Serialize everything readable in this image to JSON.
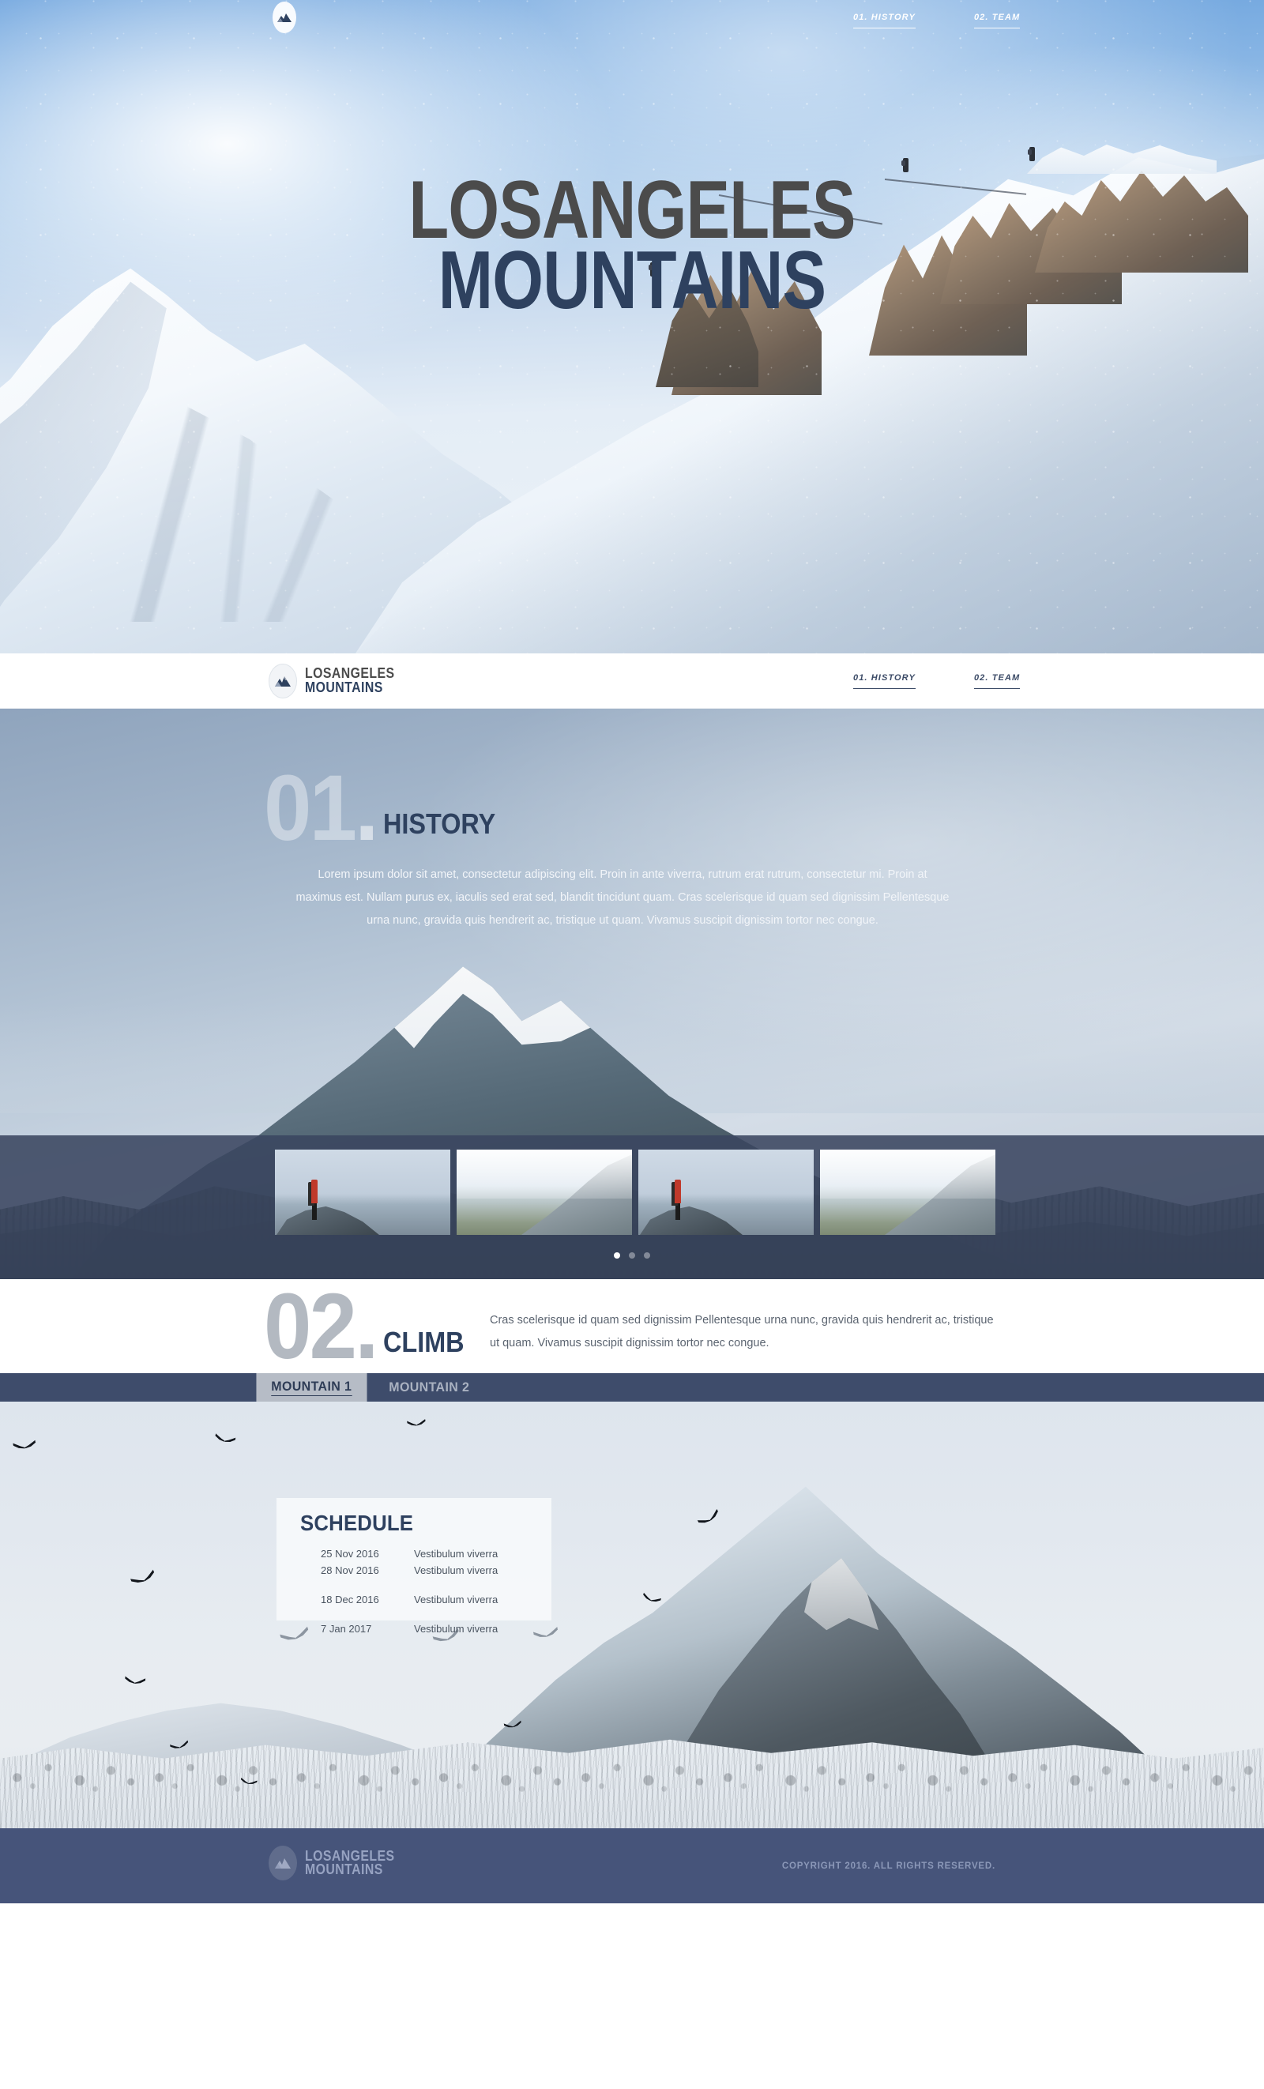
{
  "brand": {
    "line1": "LOSANGELES",
    "line2": "MOUNTAINS",
    "icon": "mountain-badge-icon"
  },
  "hero": {
    "title_top": "LOSANGELES",
    "title_bottom": "MOUNTAINS",
    "nav": [
      {
        "label": "01. HISTORY"
      },
      {
        "label": "02. TEAM"
      }
    ]
  },
  "navbar": {
    "links": [
      {
        "label": "01. HISTORY"
      },
      {
        "label": "02. TEAM"
      }
    ]
  },
  "history": {
    "number": "01",
    "dot": ".",
    "word": "HISTORY",
    "paragraph": "Lorem ipsum dolor sit amet, consectetur adipiscing elit. Proin in ante viverra, rutrum erat rutrum, consectetur mi. Proin at maximus est. Nullam purus ex, iaculis sed erat sed, blandit tincidunt quam. Cras scelerisque id quam sed dignissim Pellentesque urna nunc, gravida quis hendrerit ac, tristique ut quam. Vivamus suscipit dignissim tortor nec congue."
  },
  "gallery": {
    "thumbnails": [
      {
        "alt": "climber-on-rock"
      },
      {
        "alt": "misty-ridge"
      },
      {
        "alt": "climber-on-rock"
      },
      {
        "alt": "misty-ridge"
      }
    ],
    "dots": [
      {
        "active": true
      },
      {
        "active": false
      },
      {
        "active": false
      }
    ]
  },
  "climb": {
    "number": "02",
    "dot": ".",
    "word": "CLIMB",
    "paragraph": "Cras scelerisque id quam sed dignissim Pellentesque urna nunc, gravida quis hendrerit ac, tristique ut quam. Vivamus suscipit dignissim tortor nec congue."
  },
  "tabs": [
    {
      "label": "MOUNTAIN 1",
      "active": true
    },
    {
      "label": "MOUNTAIN 2",
      "active": false
    }
  ],
  "schedule": {
    "title": "SCHEDULE",
    "rows": [
      {
        "date": "25 Nov 2016",
        "event": "Vestibulum viverra"
      },
      {
        "date": "28 Nov 2016",
        "event": "Vestibulum viverra"
      },
      {
        "date": "18 Dec 2016",
        "event": "Vestibulum viverra"
      },
      {
        "date": "7 Jan 2017",
        "event": "Vestibulum viverra"
      }
    ]
  },
  "footer": {
    "line1": "LOSANGELES",
    "line2": "MOUNTAINS",
    "copyright": "COPYRIGHT 2016. ALL RIGHTS RESERVED."
  },
  "colors": {
    "navy": "#2e415f",
    "navy_bar": "#3e4c6b",
    "footer_navy": "#46547a",
    "title_gray": "#4b4b4b",
    "tab_active_bg": "#b6bcc6",
    "overlay_navy": "rgba(58,70,96,.88)"
  }
}
